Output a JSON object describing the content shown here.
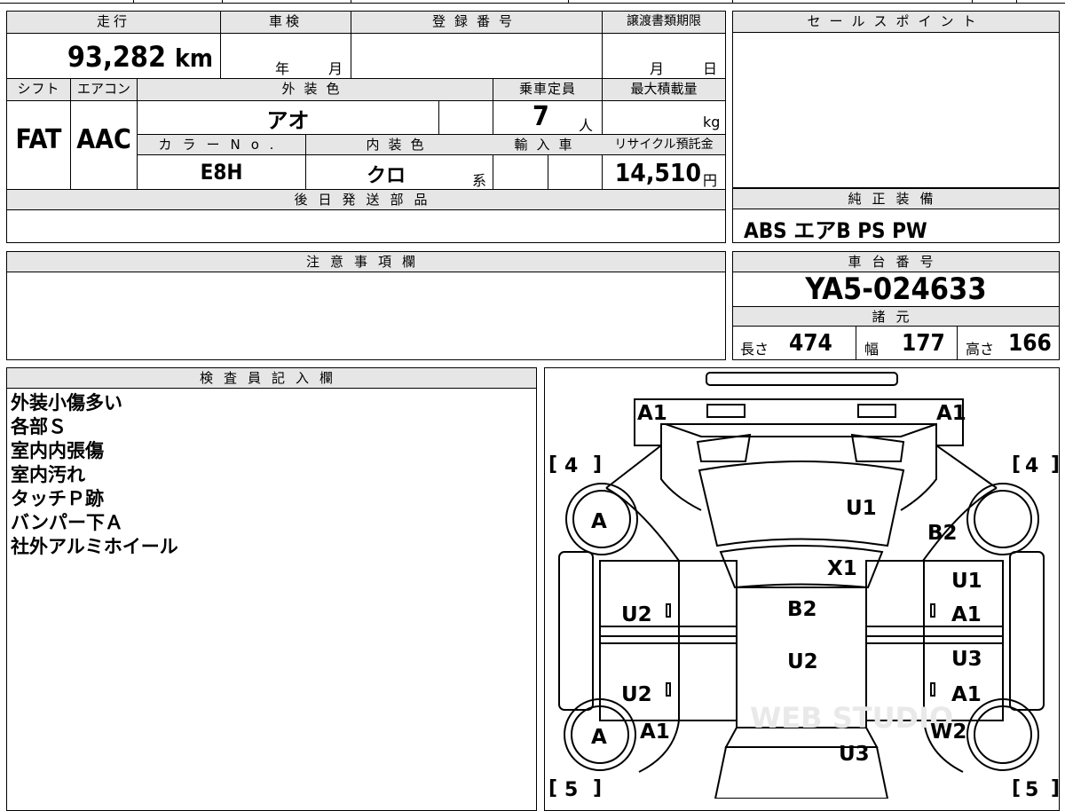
{
  "vehicle_info": {
    "mileage_label": "走行",
    "mileage_value": "93,282",
    "mileage_unit": "km",
    "inspection_label": "車検",
    "inspection_year_unit": "年",
    "inspection_month_unit": "月",
    "registration_label": "登録番号",
    "transfer_deadline_label": "譲渡書類期限",
    "transfer_month_unit": "月",
    "transfer_day_unit": "日",
    "shift_label": "シフト",
    "shift_value": "FAT",
    "aircon_label": "エアコン",
    "aircon_value": "AAC",
    "exterior_color_label": "外装色",
    "exterior_color_value": "アオ",
    "capacity_label": "乗車定員",
    "capacity_value": "7",
    "capacity_unit": "人",
    "max_load_label": "最大積載量",
    "max_load_unit": "kg",
    "color_no_label": "カラーNo.",
    "color_no_value": "E8H",
    "interior_color_label": "内装色",
    "interior_color_value": "クロ",
    "interior_color_suffix": "系",
    "import_label": "輸入車",
    "recycle_label": "リサイクル預託金",
    "recycle_value": "14,510",
    "recycle_unit": "円",
    "later_parts_label": "後日発送部品"
  },
  "sales_point": {
    "label": "セールスポイント"
  },
  "genuine_equipment": {
    "label": "純正装備",
    "value": "ABS エアB PS PW"
  },
  "caution": {
    "label": "注意事項欄"
  },
  "chassis": {
    "label": "車台番号",
    "value": "YA5-024633"
  },
  "specs": {
    "label": "諸元",
    "length_label": "長さ",
    "length_value": "474",
    "width_label": "幅",
    "width_value": "177",
    "height_label": "高さ",
    "height_value": "166"
  },
  "inspector": {
    "label": "検査員記入欄",
    "notes": [
      "外装小傷多い",
      "各部Ｓ",
      "室内内張傷",
      "室内汚れ",
      "タッチＰ跡",
      "バンパー下Ａ",
      "社外アルミホイール"
    ]
  },
  "diagram": {
    "tire_front_left": "4",
    "tire_front_right": "4",
    "tire_rear_left": "5",
    "tire_rear_right": "5",
    "marks": {
      "front_bumper_left": "A1",
      "front_bumper_right": "A1",
      "wheel_front_left": "A",
      "wheel_rear_left": "A",
      "hood": "U1",
      "fender_front_right": "B2",
      "cowl": "X1",
      "front_door_right_top": "U1",
      "front_door_right": "A1",
      "front_door_left": "U2",
      "roof_front": "B2",
      "roof_rear": "U2",
      "rear_door_right_top": "U3",
      "rear_door_right": "A1",
      "rear_door_left": "U2",
      "rear_quarter_left": "A1",
      "rear_quarter_right": "W2",
      "rear_gate": "U3"
    },
    "watermark": "WEB STUDIO"
  }
}
